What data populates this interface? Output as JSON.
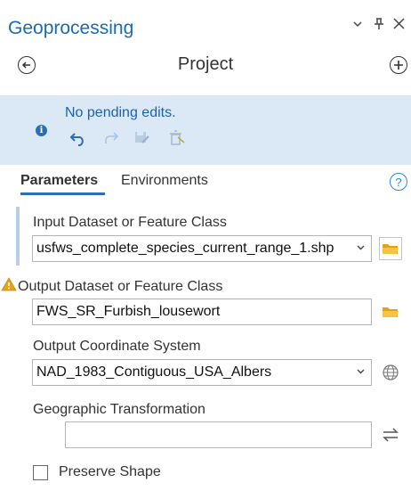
{
  "panel": {
    "title": "Geoprocessing",
    "controls": {
      "menu": "⌄",
      "pin": "ᵻ",
      "close": "✕"
    }
  },
  "nav": {
    "back_symbol": "←",
    "project_label": "Project",
    "add_symbol": "+"
  },
  "banner": {
    "info_symbol": "i",
    "message": "No pending edits."
  },
  "tabs": [
    {
      "label": "Parameters",
      "active": true
    },
    {
      "label": "Environments",
      "active": false
    }
  ],
  "help_symbol": "?",
  "params": {
    "input": {
      "label": "Input Dataset or Feature Class",
      "value": "usfws_complete_species_current_range_1.shp"
    },
    "output": {
      "label": "Output Dataset or Feature Class",
      "value": "FWS_SR_Furbish_lousewort",
      "warning": true
    },
    "coord_system": {
      "label": "Output Coordinate System",
      "value": "NAD_1983_Contiguous_USA_Albers"
    },
    "geo_transform": {
      "label": "Geographic Transformation",
      "value": ""
    },
    "preserve_shape": {
      "label": "Preserve Shape",
      "checked": false
    }
  },
  "colors": {
    "accent": "#1a6bb2",
    "banner_bg": "#dbe9f7",
    "folder": "#f0b429",
    "warning": "#e8a317"
  }
}
